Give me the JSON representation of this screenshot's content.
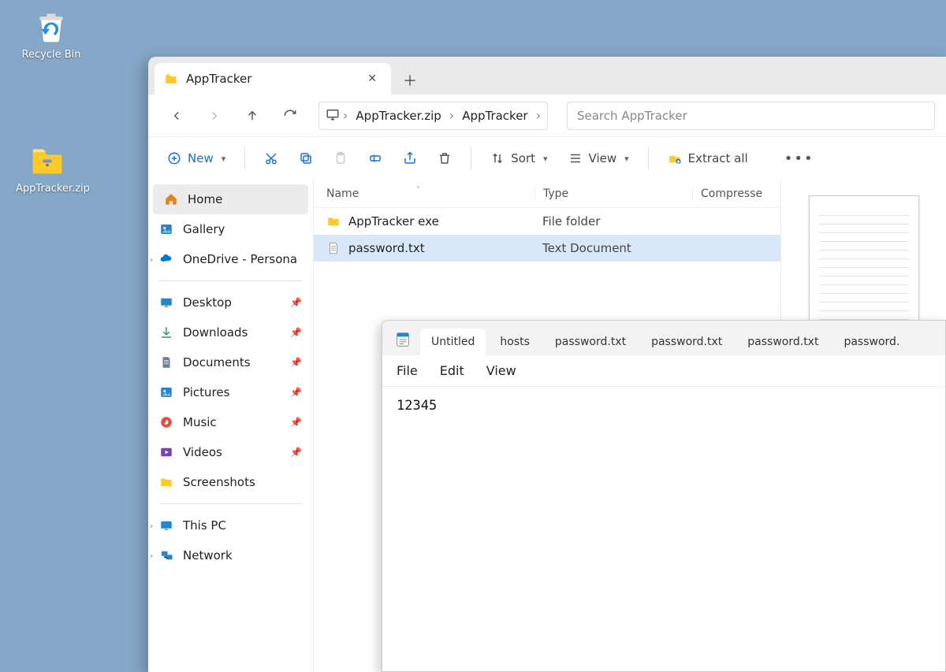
{
  "desktop": {
    "recycle_bin": "Recycle Bin",
    "zip_file": "AppTracker.zip"
  },
  "explorer": {
    "tab_title": "AppTracker",
    "breadcrumb": [
      "AppTracker.zip",
      "AppTracker"
    ],
    "search_placeholder": "Search AppTracker",
    "toolbar": {
      "new": "New",
      "sort": "Sort",
      "view": "View",
      "extract": "Extract all"
    },
    "sidebar": {
      "home": "Home",
      "gallery": "Gallery",
      "onedrive": "OneDrive - Persona",
      "desktop": "Desktop",
      "downloads": "Downloads",
      "documents": "Documents",
      "pictures": "Pictures",
      "music": "Music",
      "videos": "Videos",
      "screenshots": "Screenshots",
      "thispc": "This PC",
      "network": "Network"
    },
    "columns": {
      "name": "Name",
      "type": "Type",
      "compressed": "Compresse"
    },
    "rows": [
      {
        "name": "AppTracker exe",
        "type": "File folder",
        "icon": "folder"
      },
      {
        "name": "password.txt",
        "type": "Text Document",
        "icon": "text",
        "selected": true
      }
    ]
  },
  "notepad": {
    "tabs": [
      "Untitled",
      "hosts",
      "password.txt",
      "password.txt",
      "password.txt",
      "password."
    ],
    "menu": {
      "file": "File",
      "edit": "Edit",
      "view": "View"
    },
    "content": "12345"
  }
}
